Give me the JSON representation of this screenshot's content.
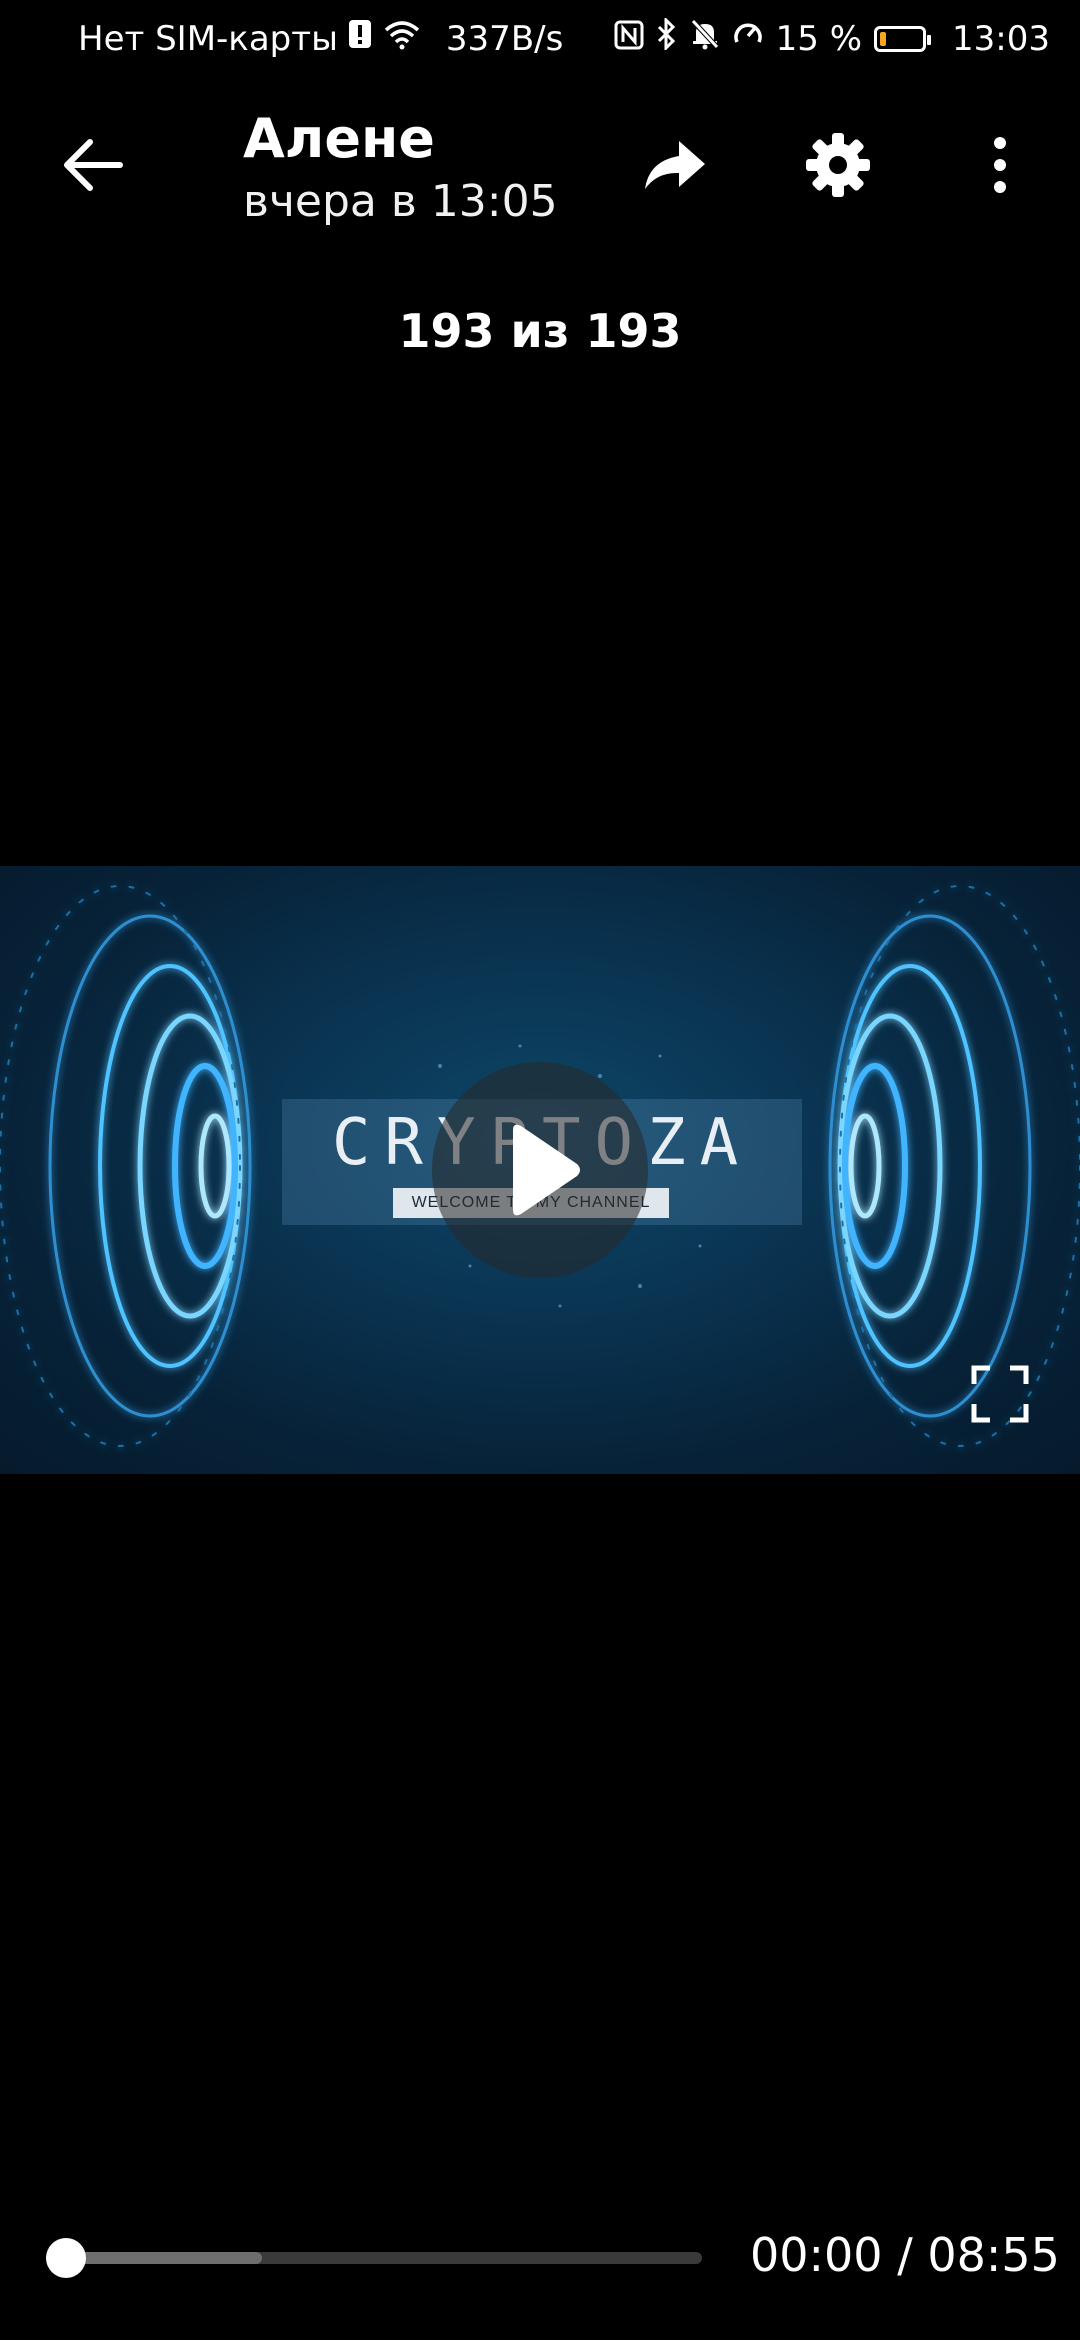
{
  "status_bar": {
    "carrier": "Нет SIM-карты",
    "network_speed": "337B/s",
    "battery_percent": "15 %",
    "battery_level": 0.15,
    "battery_color": "#f5a623",
    "time": "13:03"
  },
  "header": {
    "title": "Алене",
    "subtitle": "вчера в 13:05"
  },
  "counter": "193 из 193",
  "video": {
    "logo_text": "CRYPTOZA",
    "logo_subtitle": "WELCOME TO MY CHANNEL"
  },
  "player": {
    "current_time": "00:00",
    "separator": " / ",
    "duration": "08:55",
    "progress": 0.0,
    "buffered": 0.33
  },
  "colors": {
    "background": "#000000",
    "video_glow": "#3fb4ff"
  }
}
